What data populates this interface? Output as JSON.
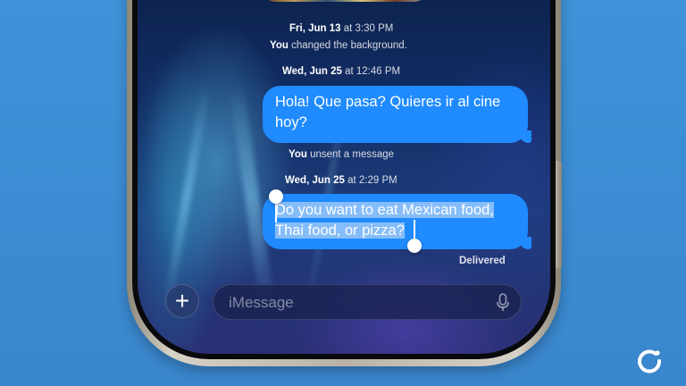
{
  "conversation": {
    "timestamp_1": {
      "day": "Fri, Jun 13",
      "time": " at 3:30 PM"
    },
    "status_1": {
      "actor": "You",
      "text": " changed the background."
    },
    "timestamp_2": {
      "day": "Wed, Jun 25",
      "time": " at 12:46 PM"
    },
    "message_1": "Hola! Que pasa? Quieres ir al cine hoy?",
    "status_2": {
      "actor": "You",
      "text": " unsent a message"
    },
    "timestamp_3": {
      "day": "Wed, Jun 25",
      "time": " at 2:29 PM"
    },
    "message_2": "Do you want to eat Mexican food, Thai food, or pizza?",
    "delivery_status": "Delivered"
  },
  "composer": {
    "plus_label": "+",
    "placeholder": "iMessage"
  },
  "colors": {
    "bubble_blue": "#1f8bff",
    "background_blue": "#3b8cd2",
    "selection": "#aacdf5"
  },
  "icons": [
    "plus-icon",
    "microphone-icon",
    "brand-logo-icon"
  ]
}
